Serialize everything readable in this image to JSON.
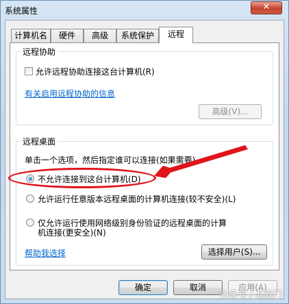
{
  "window": {
    "title": "系统属性",
    "close_label": "✕"
  },
  "tabs": [
    {
      "label": "计算机名",
      "active": false
    },
    {
      "label": "硬件",
      "active": false
    },
    {
      "label": "高级",
      "active": false
    },
    {
      "label": "系统保护",
      "active": false
    },
    {
      "label": "远程",
      "active": true
    }
  ],
  "remote_assistance": {
    "title": "远程协助",
    "allow_checkbox_label": "允许远程协助连接这台计算机(R)",
    "allow_checked": false,
    "info_link": "有关启用远程协助的信息",
    "advanced_button": "高级(V)..."
  },
  "remote_desktop": {
    "title": "远程桌面",
    "instruction": "单击一个选项，然后指定谁可以连接(如果需要)。",
    "options": [
      {
        "label": "不允许连接到这台计算机(D)",
        "selected": true
      },
      {
        "label": "允许运行任意版本远程桌面的计算机连接(较不安全)(L)",
        "selected": false
      },
      {
        "label_line1": "仅允许运行使用网络级别身份验证的远程桌面的计算",
        "label_line2": "机连接(更安全)(N)",
        "selected": false
      }
    ],
    "help_link": "帮助我选择",
    "select_users_button": "选择用户(S)..."
  },
  "footer": {
    "ok": "确定",
    "cancel": "取消",
    "apply": "应用(A)"
  },
  "watermark": "头条号 / 北麦门",
  "colors": {
    "annotation_red": "#e0141b",
    "link_blue": "#0066cc"
  }
}
